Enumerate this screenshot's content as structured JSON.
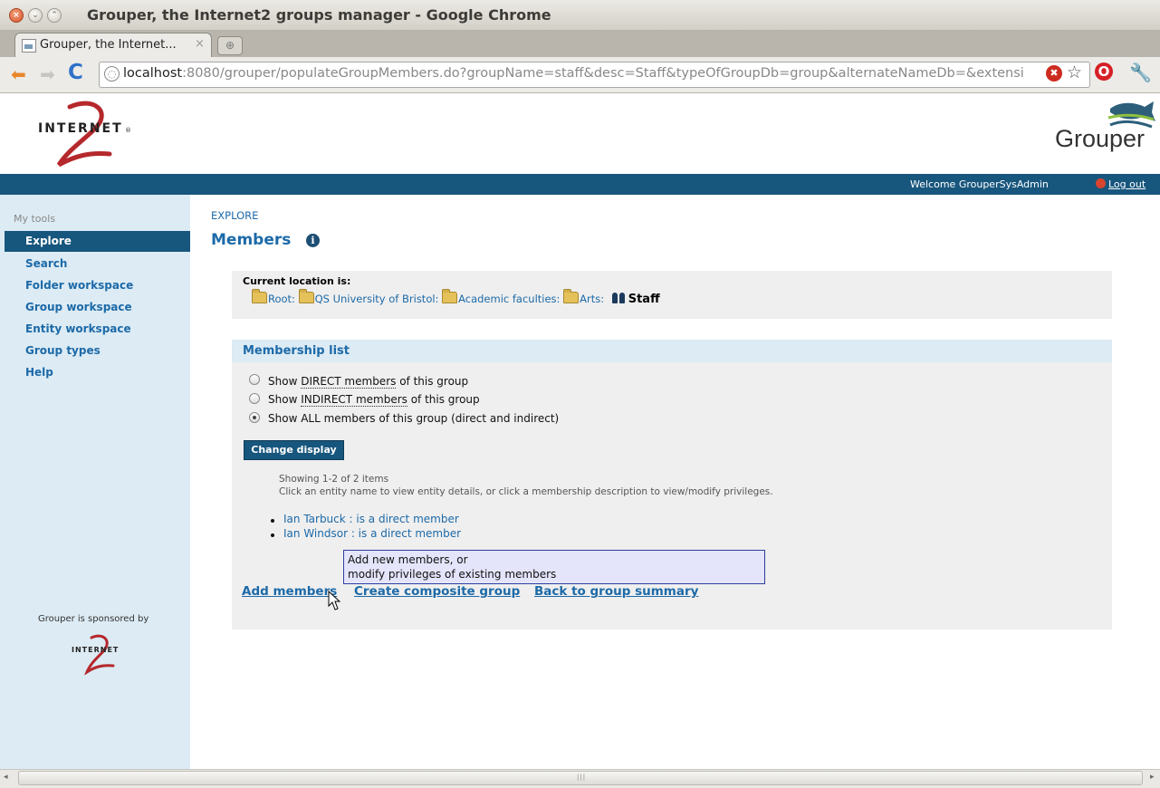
{
  "window": {
    "title": "Grouper, the Internet2 groups manager - Google Chrome",
    "close_glyph": "×",
    "min_glyph": "⌄",
    "max_glyph": "⌃"
  },
  "tab": {
    "title": "Grouper, the Internet...",
    "close_glyph": "×",
    "newtab_glyph": "⊕"
  },
  "toolbar": {
    "back_glyph": "⬅",
    "forward_glyph": "➡",
    "reload_glyph": "C",
    "url_host": "localhost",
    "url_rest": ":8080/grouper/populateGroupMembers.do?groupName=staff&desc=Staff&typeOfGroupDb=group&alternateNameDb=&extensi",
    "ext_glyph": "✖",
    "star_glyph": "☆",
    "opera_glyph": "O",
    "wrench_glyph": "🔧"
  },
  "header": {
    "internet2_logo": "INTERNET",
    "grouper_logo": "Grouper",
    "welcome": "Welcome GrouperSysAdmin",
    "logout": "Log out"
  },
  "sidebar": {
    "heading": "My tools",
    "items": [
      {
        "label": "Explore",
        "active": true
      },
      {
        "label": "Search"
      },
      {
        "label": "Folder workspace"
      },
      {
        "label": "Group workspace"
      },
      {
        "label": "Entity workspace"
      },
      {
        "label": "Group types"
      },
      {
        "label": "Help"
      }
    ],
    "sponsored": "Grouper is sponsored by",
    "sponsor_logo": "INTERNET"
  },
  "main": {
    "breadcrumb": "EXPLORE",
    "title": "Members",
    "info_glyph": "i",
    "location_label": "Current location is:",
    "path": [
      {
        "label": "Root:"
      },
      {
        "label": "QS University of Bristol:"
      },
      {
        "label": "Academic faculties:"
      },
      {
        "label": "Arts:"
      }
    ],
    "current_group": "Staff",
    "membership_header": "Membership list",
    "options": {
      "direct_pre": "Show ",
      "direct_word": "DIRECT members",
      "direct_post": " of this group",
      "indirect_pre": "Show ",
      "indirect_word": "INDIRECT members",
      "indirect_post": " of this group",
      "all": "Show ALL members of this group (direct and indirect)",
      "selected": "all"
    },
    "change_display": "Change display",
    "showing": "Showing 1-2 of 2 items",
    "hint": "Click an entity name to view entity details, or click a membership description to view/modify privileges.",
    "members": [
      {
        "name": "Ian Tarbuck",
        "sep": " : ",
        "desc": "is a direct member"
      },
      {
        "name": "Ian Windsor",
        "sep": " : ",
        "desc": "is a direct member"
      }
    ],
    "tooltip": [
      "Add new members, or",
      "modify privileges of existing members"
    ],
    "actions": [
      "Add members",
      "Create composite group",
      "Back to group summary"
    ]
  },
  "scrollbar": {
    "left_glyph": "◂",
    "grip": "|||",
    "right_glyph": "▸"
  },
  "colors": {
    "brand_blue": "#17567d",
    "link_blue": "#1d6aa8",
    "sidebar_bg": "#dcebf4"
  }
}
